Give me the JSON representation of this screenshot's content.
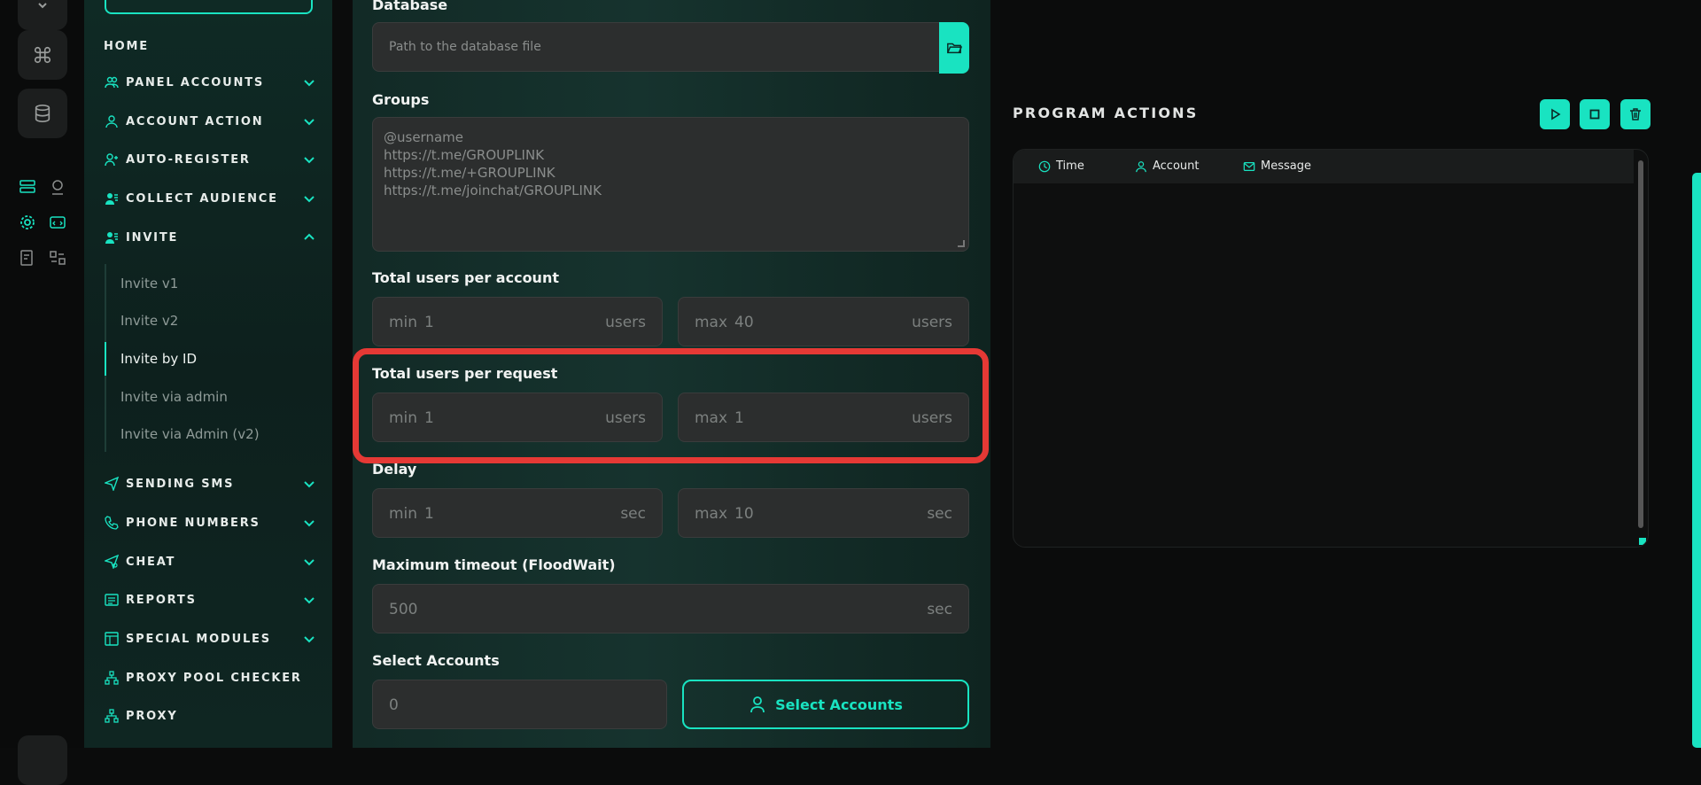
{
  "colors": {
    "accent": "#19e3c1",
    "highlight": "#e53935",
    "sidebar_bg": "#0f2a25",
    "panel_bg": "#16332e"
  },
  "rail": {
    "buttons": [
      {
        "icon": "chevron-down-icon",
        "glyph": "⌄"
      },
      {
        "icon": "command-icon",
        "glyph": "⌘"
      },
      {
        "icon": "database-icon",
        "glyph": ""
      }
    ]
  },
  "sidebar": {
    "items": [
      {
        "label": "HOME",
        "icon": "",
        "has_chevron": false,
        "expanded": false
      },
      {
        "label": "PANEL ACCOUNTS",
        "icon": "users-icon",
        "has_chevron": true,
        "expanded": false
      },
      {
        "label": "ACCOUNT ACTION",
        "icon": "user-icon",
        "has_chevron": true,
        "expanded": false
      },
      {
        "label": "AUTO-REGISTER",
        "icon": "user-plus-icon",
        "has_chevron": true,
        "expanded": false
      },
      {
        "label": "COLLECT AUDIENCE",
        "icon": "user-list-icon",
        "has_chevron": true,
        "expanded": false
      },
      {
        "label": "INVITE",
        "icon": "user-list-icon",
        "has_chevron": true,
        "expanded": true
      },
      {
        "label": "SENDING SMS",
        "icon": "send-icon",
        "has_chevron": true,
        "expanded": false
      },
      {
        "label": "PHONE NUMBERS",
        "icon": "phone-icon",
        "has_chevron": true,
        "expanded": false
      },
      {
        "label": "CHEAT",
        "icon": "send-gear-icon",
        "has_chevron": true,
        "expanded": false
      },
      {
        "label": "REPORTS",
        "icon": "report-icon",
        "has_chevron": true,
        "expanded": false
      },
      {
        "label": "SPECIAL MODULES",
        "icon": "modules-icon",
        "has_chevron": true,
        "expanded": false
      },
      {
        "label": "PROXY POOL CHECKER",
        "icon": "network-icon",
        "has_chevron": false,
        "expanded": false
      },
      {
        "label": "PROXY",
        "icon": "network-icon",
        "has_chevron": false,
        "expanded": false
      }
    ],
    "invite_subitems": [
      {
        "label": "Invite v1",
        "active": false
      },
      {
        "label": "Invite v2",
        "active": false
      },
      {
        "label": "Invite by ID",
        "active": true
      },
      {
        "label": "Invite via admin",
        "active": false
      },
      {
        "label": "Invite via Admin (v2)",
        "active": false
      }
    ]
  },
  "form": {
    "database": {
      "label": "Database",
      "placeholder": "Path to the database file"
    },
    "groups": {
      "label": "Groups",
      "placeholder_lines": [
        "@username",
        "https://t.me/GROUPLINK",
        "https://t.me/+GROUPLINK",
        "https://t.me/joinchat/GROUPLINK"
      ]
    },
    "total_users_per_account": {
      "label": "Total users per account",
      "min_prefix": "min",
      "min": "1",
      "max_prefix": "max",
      "max": "40",
      "unit": "users"
    },
    "total_users_per_request": {
      "label": "Total users per request",
      "min_prefix": "min",
      "min": "1",
      "max_prefix": "max",
      "max": "1",
      "unit": "users"
    },
    "delay": {
      "label": "Delay",
      "min_prefix": "min",
      "min": "1",
      "max_prefix": "max",
      "max": "10",
      "unit": "sec"
    },
    "max_timeout": {
      "label": "Maximum timeout (FloodWait)",
      "value": "500",
      "unit": "sec"
    },
    "select_accounts": {
      "label": "Select Accounts",
      "count": "0",
      "button_label": "Select Accounts"
    }
  },
  "program_actions": {
    "title": "PROGRAM ACTIONS",
    "buttons": [
      "play-icon",
      "stop-icon",
      "trash-icon"
    ],
    "columns": [
      {
        "label": "Time",
        "icon": "clock-icon"
      },
      {
        "label": "Account",
        "icon": "user-icon"
      },
      {
        "label": "Message",
        "icon": "mail-icon"
      }
    ]
  }
}
